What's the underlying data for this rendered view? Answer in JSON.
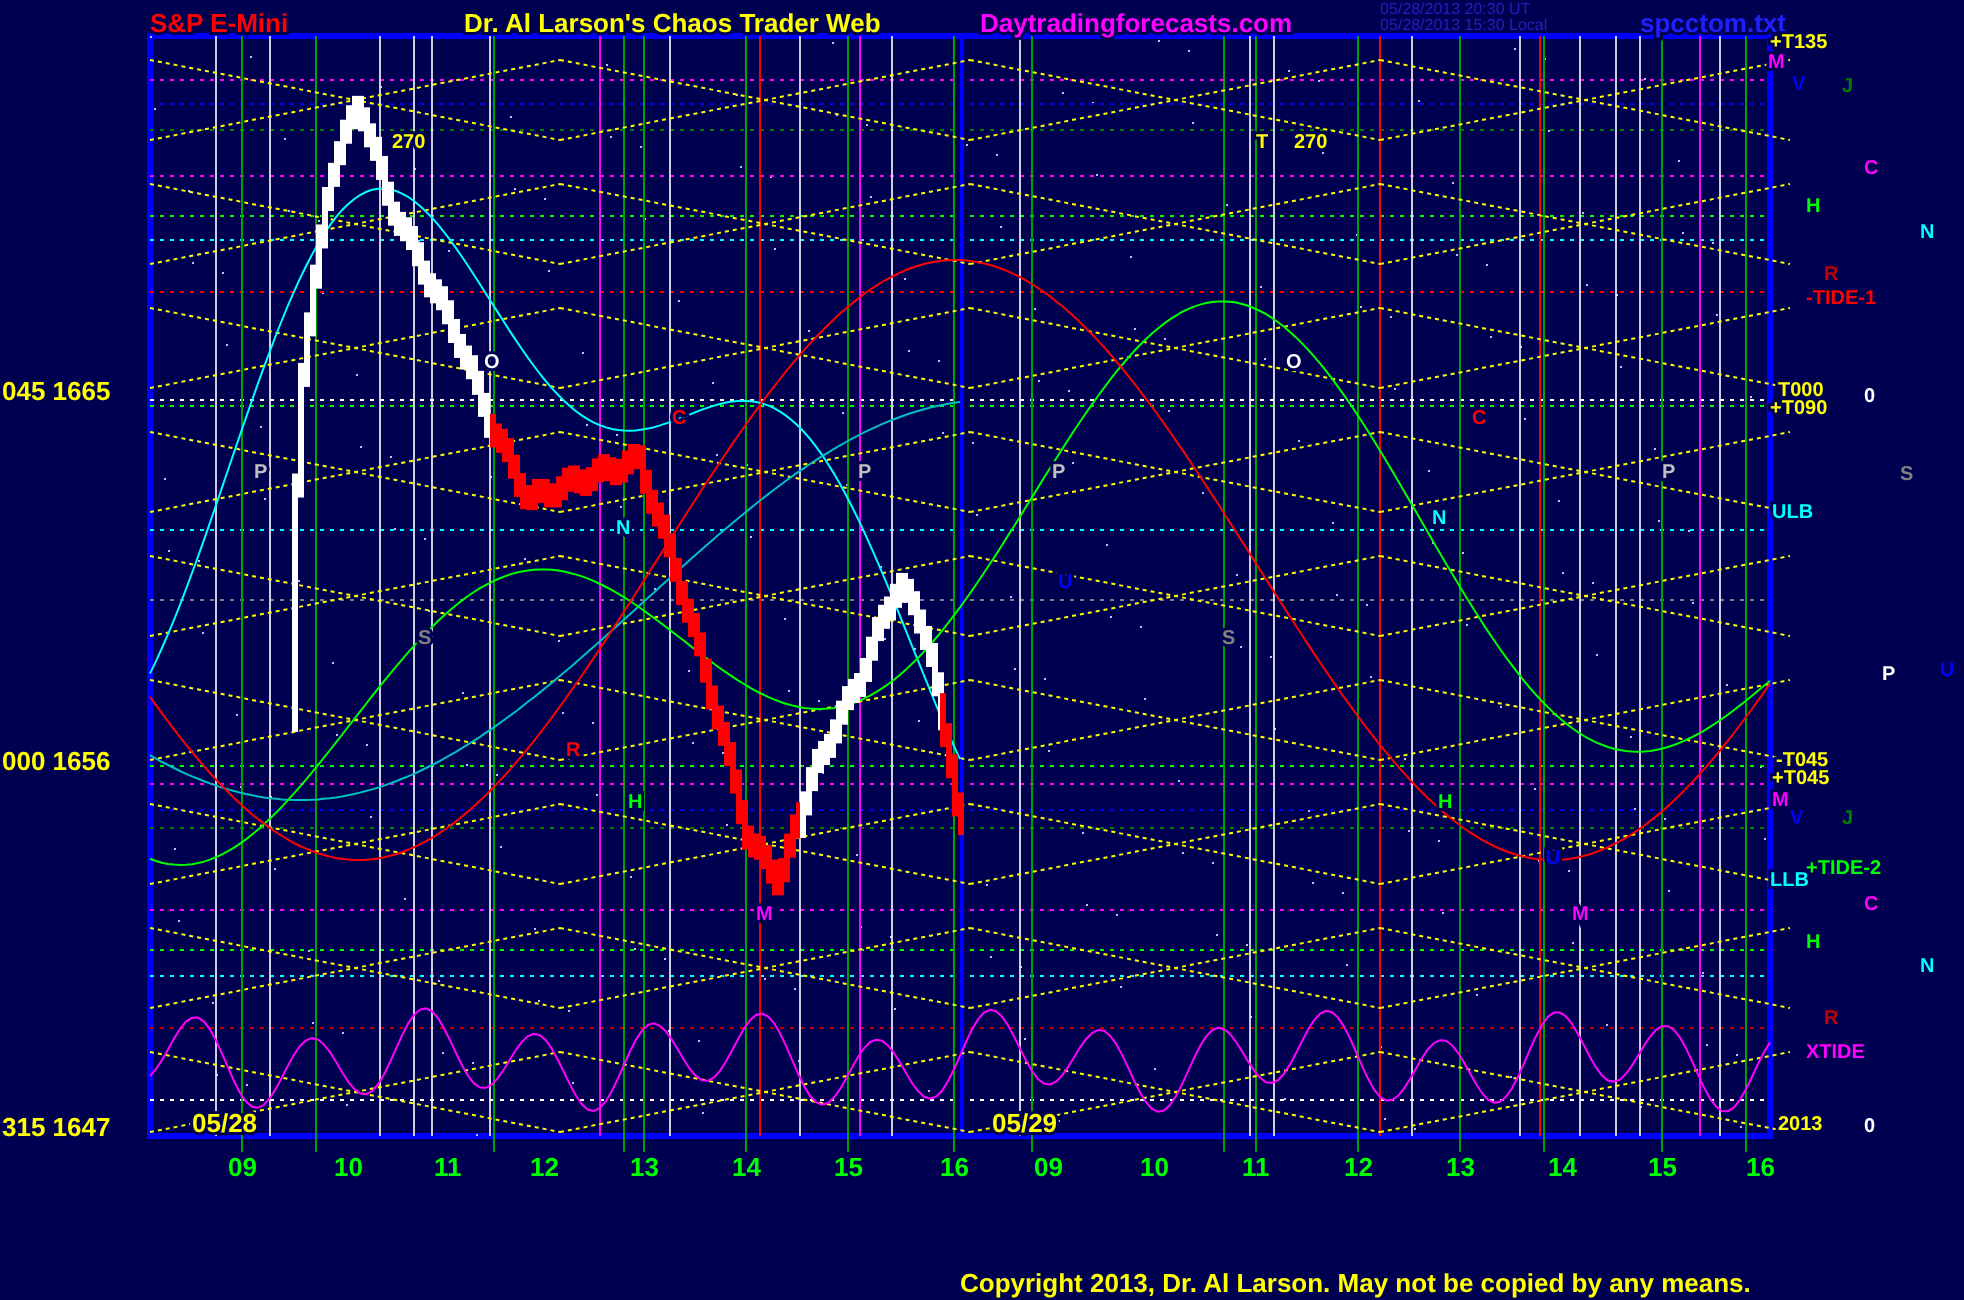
{
  "header": {
    "symbol": "S&P E-Mini",
    "title": "Dr. Al Larson's Chaos Trader Web",
    "site": "Daytradingforecasts.com",
    "timestamps": [
      "05/28/2013 20:30 UT",
      "05/28/2013 15:30 Local"
    ],
    "file": "spcctom.txt"
  },
  "y_axis_labels": [
    "045 1665",
    "000 1656",
    "315 1647"
  ],
  "x_axis_labels": [
    "09",
    "10",
    "11",
    "12",
    "13",
    "14",
    "15",
    "16",
    "09",
    "10",
    "11",
    "12",
    "13",
    "14",
    "15",
    "16"
  ],
  "date_labels": [
    "05/28",
    "05/29"
  ],
  "plot_markers": [
    {
      "text": "270",
      "color": "#ffff00"
    },
    {
      "text": "T",
      "color": "#ffff00"
    },
    {
      "text": "270",
      "color": "#ffff00"
    },
    {
      "text": "O",
      "color": "#ffffff"
    },
    {
      "text": "O",
      "color": "#ffffff"
    },
    {
      "text": "P",
      "color": "#c0c0c0"
    },
    {
      "text": "P",
      "color": "#c0c0c0"
    },
    {
      "text": "P",
      "color": "#c0c0c0"
    },
    {
      "text": "P",
      "color": "#c0c0c0"
    },
    {
      "text": "C",
      "color": "#ff0000"
    },
    {
      "text": "C",
      "color": "#ff0000"
    },
    {
      "text": "N",
      "color": "#00ffff"
    },
    {
      "text": "N",
      "color": "#00ffff"
    },
    {
      "text": "U",
      "color": "#0000ff"
    },
    {
      "text": "S",
      "color": "#808080"
    },
    {
      "text": "S",
      "color": "#808080"
    },
    {
      "text": "R",
      "color": "#ff0000"
    },
    {
      "text": "H",
      "color": "#00ff00"
    },
    {
      "text": "H",
      "color": "#00ff00"
    },
    {
      "text": "U",
      "color": "#0000ff"
    },
    {
      "text": "M",
      "color": "#ff00ff"
    },
    {
      "text": "M",
      "color": "#ff00ff"
    }
  ],
  "right_labels": [
    {
      "text": "+T135",
      "color": "#ffff00"
    },
    {
      "text": "M",
      "color": "#ff00ff"
    },
    {
      "text": "V",
      "color": "#0000ff"
    },
    {
      "text": "J",
      "color": "#008000"
    },
    {
      "text": "C",
      "color": "#ff00ff"
    },
    {
      "text": "H",
      "color": "#00ff00"
    },
    {
      "text": "N",
      "color": "#00ffff"
    },
    {
      "text": "R",
      "color": "#c00000"
    },
    {
      "text": "-TIDE-1",
      "color": "#ff0000"
    },
    {
      "text": "T000",
      "color": "#ffff00"
    },
    {
      "text": "0",
      "color": "#ffffff"
    },
    {
      "text": "+T090",
      "color": "#ffff00"
    },
    {
      "text": "S",
      "color": "#808080"
    },
    {
      "text": "ULB",
      "color": "#00ffff"
    },
    {
      "text": "P",
      "color": "#ffffff"
    },
    {
      "text": "U",
      "color": "#0000ff"
    },
    {
      "text": "-T045",
      "color": "#ffff00"
    },
    {
      "text": "+T045",
      "color": "#ffff00"
    },
    {
      "text": "M",
      "color": "#ff00ff"
    },
    {
      "text": "V",
      "color": "#0000ff"
    },
    {
      "text": "J",
      "color": "#008000"
    },
    {
      "text": "+TIDE-2",
      "color": "#00ff00"
    },
    {
      "text": "LLB",
      "color": "#00ffff"
    },
    {
      "text": "C",
      "color": "#ff00ff"
    },
    {
      "text": "H",
      "color": "#00ff00"
    },
    {
      "text": "N",
      "color": "#00ffff"
    },
    {
      "text": "R",
      "color": "#c00000"
    },
    {
      "text": "XTIDE",
      "color": "#ff00ff"
    },
    {
      "text": "2013",
      "color": "#ffff00"
    },
    {
      "text": "0",
      "color": "#ffffff"
    }
  ],
  "copyright": "Copyright 2013, Dr. Al Larson. May not be copied by any means."
}
